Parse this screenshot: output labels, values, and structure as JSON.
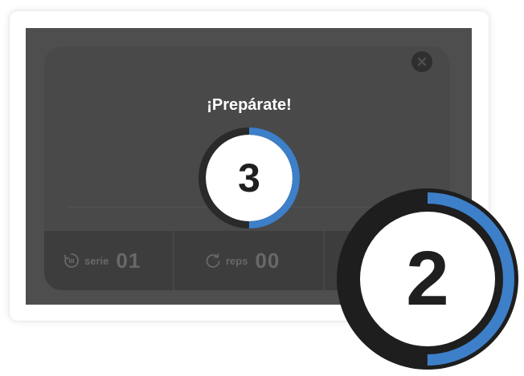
{
  "modal": {
    "title": "¡Prepárate!",
    "countdown_value": "3",
    "countdown_progress": 0.5
  },
  "stats": {
    "serie_label": "serie",
    "serie_value": "01",
    "reps_label": "reps",
    "reps_value": "00"
  },
  "big_countdown": {
    "value": "2",
    "progress": 0.5
  },
  "icons": {
    "close": "close-icon",
    "serie": "series-icon",
    "reps": "reps-icon"
  },
  "colors": {
    "accent": "#3d7fc9",
    "ring": "#2a2a2a",
    "overlay": "#4e4e4e",
    "panel": "#494949",
    "stats_bar": "#3d3d3d"
  }
}
